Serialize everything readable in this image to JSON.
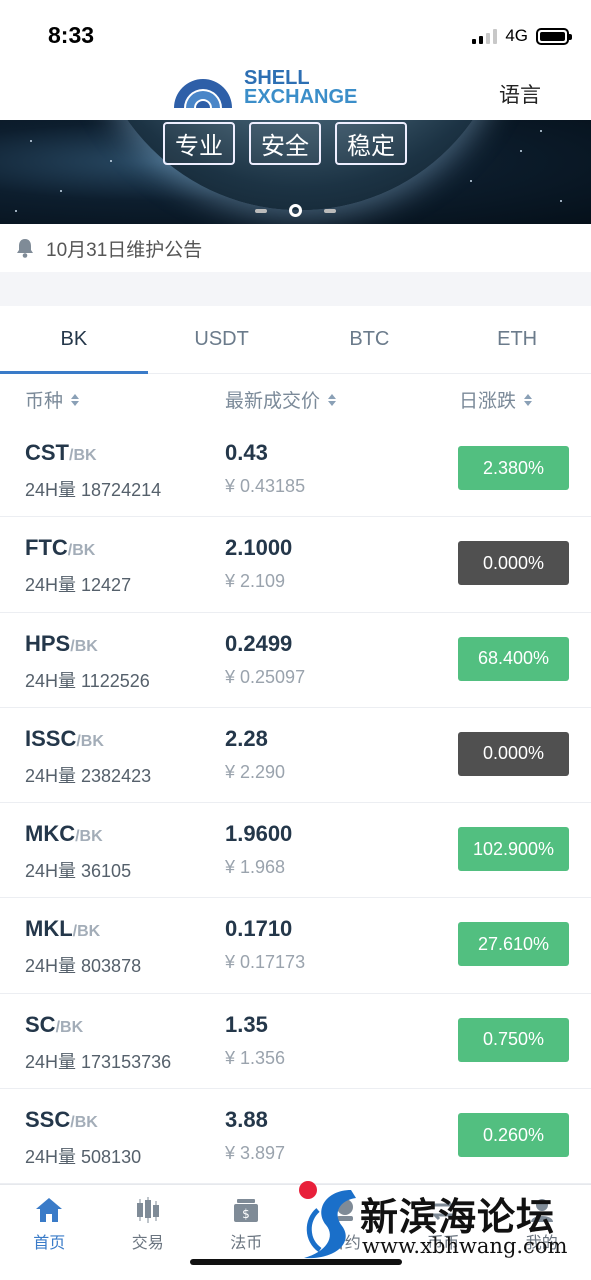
{
  "status": {
    "time": "8:33",
    "network": "4G"
  },
  "header": {
    "logo_line1": "SHELL",
    "logo_line2": "EXCHANGE",
    "language_label": "语言"
  },
  "banner": {
    "tags": [
      "专业",
      "安全",
      "稳定"
    ],
    "active_slide": 2,
    "slide_count": 3
  },
  "notice": {
    "text": "10月31日维护公告"
  },
  "tabs": [
    {
      "label": "BK",
      "active": true
    },
    {
      "label": "USDT",
      "active": false
    },
    {
      "label": "BTC",
      "active": false
    },
    {
      "label": "ETH",
      "active": false
    }
  ],
  "columns": {
    "coin": "币种",
    "price": "最新成交价",
    "change": "日涨跌"
  },
  "markets": [
    {
      "coin": "CST",
      "quote": "/BK",
      "volume": "24H量 18724214",
      "price": "0.43",
      "cny": "¥ 0.43185",
      "change": "2.380%",
      "trend": "up"
    },
    {
      "coin": "FTC",
      "quote": "/BK",
      "volume": "24H量 12427",
      "price": "2.1000",
      "cny": "¥ 2.109",
      "change": "0.000%",
      "trend": "flat"
    },
    {
      "coin": "HPS",
      "quote": "/BK",
      "volume": "24H量 1122526",
      "price": "0.2499",
      "cny": "¥ 0.25097",
      "change": "68.400%",
      "trend": "up"
    },
    {
      "coin": "ISSC",
      "quote": "/BK",
      "volume": "24H量 2382423",
      "price": "2.28",
      "cny": "¥ 2.290",
      "change": "0.000%",
      "trend": "flat"
    },
    {
      "coin": "MKC",
      "quote": "/BK",
      "volume": "24H量 36105",
      "price": "1.9600",
      "cny": "¥ 1.968",
      "change": "102.900%",
      "trend": "up"
    },
    {
      "coin": "MKL",
      "quote": "/BK",
      "volume": "24H量 803878",
      "price": "0.1710",
      "cny": "¥ 0.17173",
      "change": "27.610%",
      "trend": "up"
    },
    {
      "coin": "SC",
      "quote": "/BK",
      "volume": "24H量 173153736",
      "price": "1.35",
      "cny": "¥ 1.356",
      "change": "0.750%",
      "trend": "up"
    },
    {
      "coin": "SSC",
      "quote": "/BK",
      "volume": "24H量 508130",
      "price": "3.88",
      "cny": "¥ 3.897",
      "change": "0.260%",
      "trend": "up"
    }
  ],
  "colors": {
    "up": "#52bf80",
    "flat": "#505050",
    "accent": "#3a7bc8"
  },
  "bottom_nav": [
    {
      "label": "首页",
      "icon": "home-icon",
      "active": true
    },
    {
      "label": "交易",
      "icon": "candlestick-icon",
      "active": false
    },
    {
      "label": "法币",
      "icon": "wallet-icon",
      "active": false
    },
    {
      "label": "合约",
      "icon": "contract-icon",
      "active": false
    },
    {
      "label": "币币",
      "icon": "exchange-icon",
      "active": false
    },
    {
      "label": "我的",
      "icon": "user-icon",
      "active": false
    }
  ],
  "watermark": {
    "title": "新滨海论坛",
    "url": "www.xbhwang.com"
  }
}
